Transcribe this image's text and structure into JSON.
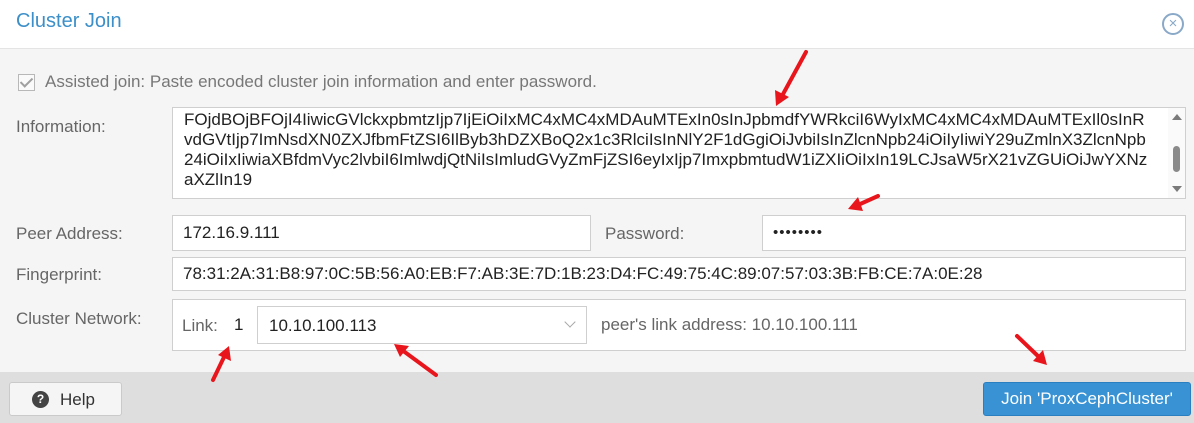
{
  "dialog": {
    "title": "Cluster Join",
    "close_icon": "×"
  },
  "assisted_join": {
    "checked": true,
    "label": "Assisted join: Paste encoded cluster join information and enter password."
  },
  "information": {
    "label": "Information:",
    "value": "FOjdBOjBFOjI4IiwicGVlckxpbmtzIjp7IjEiOiIxMC4xMC4xMDAuMTExIn0sInJpbmdfYWRkciI6WyIxMC4xMC4xMDAuMTExIl0sInRvdGVtIjp7ImNsdXN0ZXJfbmFtZSI6IlByb3hDZXBoQ2x1c3RlciIsInNlY2F1dGgiOiJvbiIsInZlcnNpb24iOiIyIiwiY29uZmlnX3ZlcnNpb24iOiIxIiwiaXBfdmVyc2lvbiI6ImlwdjQtNiIsImludGVyZmFjZSI6eyIxIjp7ImxpbmtudW1iZXIiOiIxIn19LCJsaW5rX21vZGUiOiJwYXNzaXZlIn19"
  },
  "peer_address": {
    "label": "Peer Address:",
    "value": "172.16.9.111"
  },
  "password": {
    "label": "Password:",
    "value": "••••••••"
  },
  "fingerprint": {
    "label": "Fingerprint:",
    "value": "78:31:2A:31:B8:97:0C:5B:56:A0:EB:F7:AB:3E:7D:1B:23:D4:FC:49:75:4C:89:07:57:03:3B:FB:CE:7A:0E:28"
  },
  "cluster_network": {
    "label": "Cluster Network:",
    "link_label": "Link:",
    "link_number": "1",
    "link_address": "10.10.100.113",
    "peer_link_text": "peer's link address: 10.10.100.111"
  },
  "footer": {
    "help_label": "Help",
    "help_icon": "?",
    "join_label": "Join 'ProxCephCluster'"
  },
  "colors": {
    "accent": "#3c8fc9",
    "join_button": "#3892d4",
    "annotation_arrow": "#e8161c"
  }
}
